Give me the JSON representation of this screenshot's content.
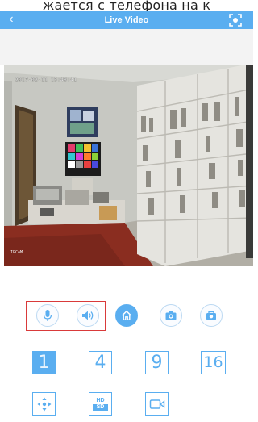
{
  "caption_text": "жается с телефона на к",
  "header": {
    "back_glyph": "‹",
    "title": "Live Video",
    "fullscreen_icon": "fullscreen-icon"
  },
  "video": {
    "osd_time": "2017-02-11 15:48:41",
    "osd_name": "IPCAM",
    "colors": {
      "wall": "#c9c9c4",
      "floor": "#8a2d20",
      "shelf": "#f2f2ee"
    }
  },
  "controls": {
    "items": [
      {
        "name": "microphone",
        "icon": "microphone-icon"
      },
      {
        "name": "speaker",
        "icon": "speaker-icon"
      },
      {
        "name": "home",
        "icon": "home-icon"
      },
      {
        "name": "snapshot",
        "icon": "camera-icon"
      },
      {
        "name": "record",
        "icon": "record-icon"
      }
    ],
    "highlight_color": "#d93a3a"
  },
  "split_view": {
    "options": [
      "1",
      "4",
      "9",
      "16"
    ],
    "selected": "1"
  },
  "tools": {
    "ptz_icon": "ptz-arrows-icon",
    "quality_hd": "HD",
    "quality_sd": "SD",
    "video_icon": "video-camera-icon"
  },
  "colors": {
    "accent": "#5aaef0",
    "background": "#ffffff"
  }
}
